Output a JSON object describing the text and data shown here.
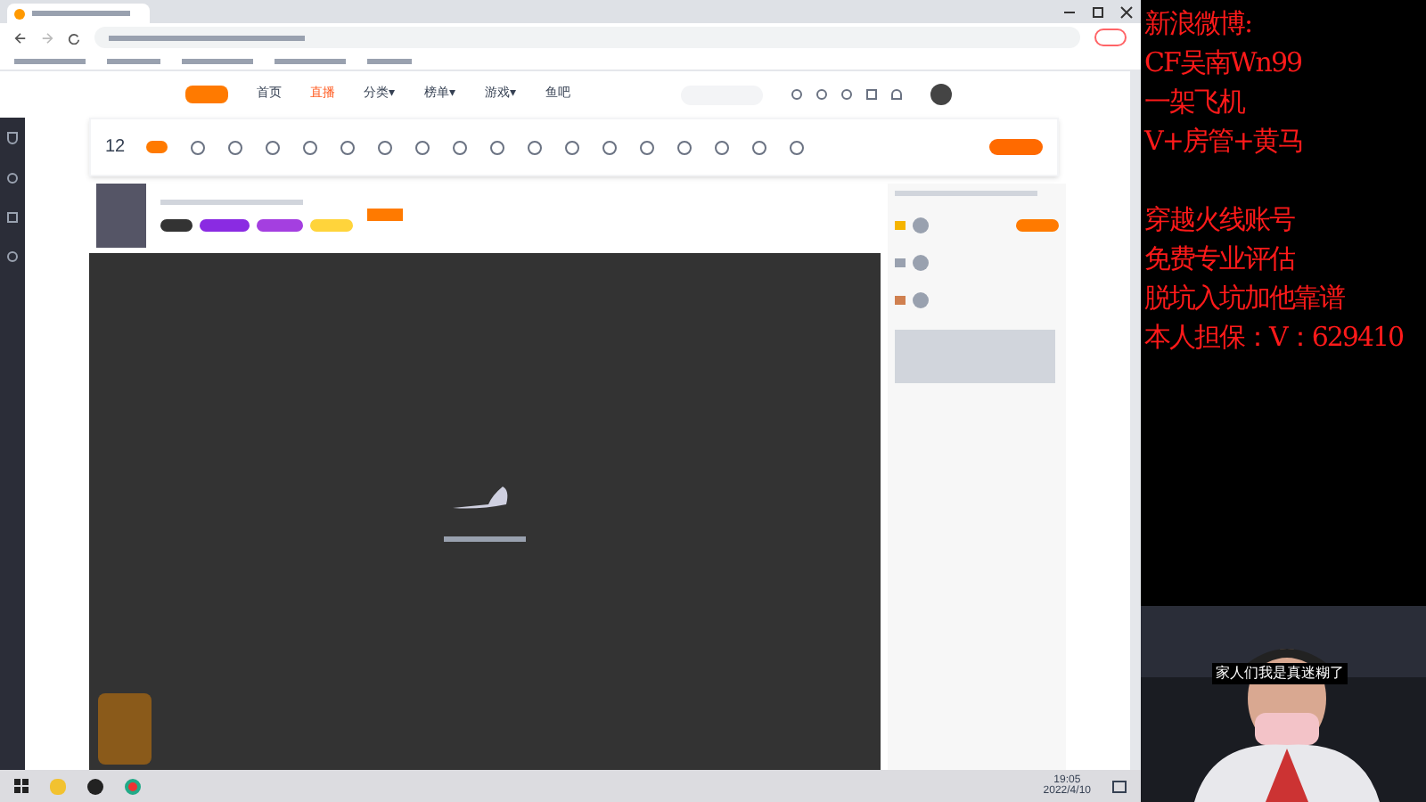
{
  "site_nav": [
    {
      "label": "首页",
      "selected": false
    },
    {
      "label": "直播",
      "selected": true
    },
    {
      "label": "分类▾",
      "selected": false
    },
    {
      "label": "榜单▾",
      "selected": false
    },
    {
      "label": "游戏▾",
      "selected": false
    },
    {
      "label": "鱼吧",
      "selected": false
    }
  ],
  "toolbar": {
    "count": "12"
  },
  "overlay_blocks": [
    [
      "新浪微博:",
      "CF吴南Wn99",
      "一架飞机",
      "V+房管+黄马"
    ],
    [
      "穿越火线账号",
      "免费专业评估",
      "脱坑入坑加他靠谱",
      "本人担保：V：629410"
    ]
  ],
  "webcam": {
    "caption": "家人们我是真迷糊了"
  },
  "taskbar": {
    "time": "19:05",
    "date": "2022/4/10"
  }
}
